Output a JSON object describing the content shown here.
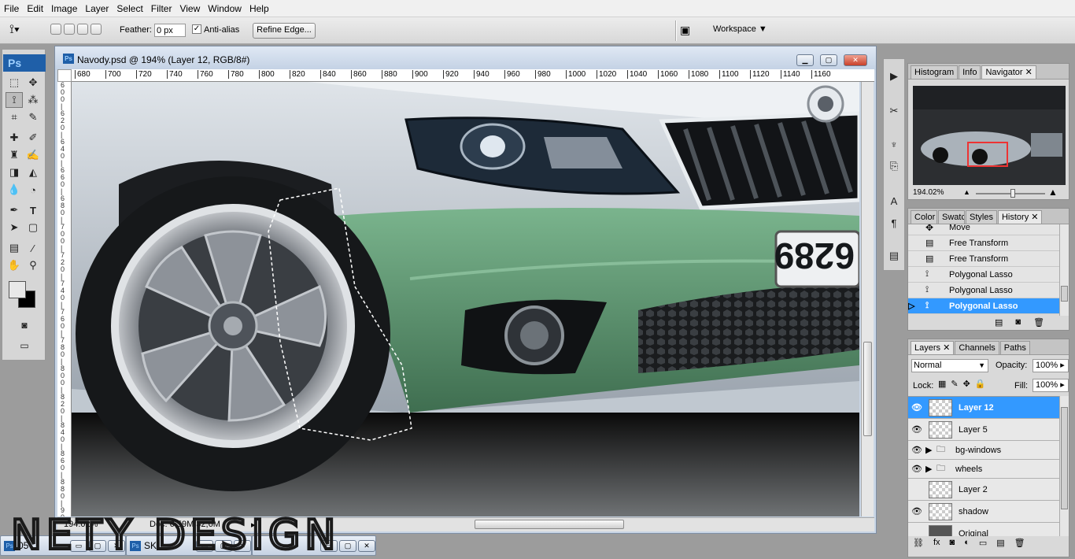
{
  "menu": [
    "File",
    "Edit",
    "Image",
    "Layer",
    "Select",
    "Filter",
    "View",
    "Window",
    "Help"
  ],
  "options": {
    "feather_label": "Feather:",
    "feather_value": "0 px",
    "antialias_label": "Anti-alias",
    "antialias_checked": true,
    "refine_edge": "Refine Edge...",
    "workspace": "Workspace"
  },
  "toolbox": {
    "logo": "Ps"
  },
  "document": {
    "title": "Navody.psd @ 194% (Layer 12, RGB/8#)",
    "ruler_ticks": [
      "680",
      "700",
      "720",
      "740",
      "760",
      "780",
      "800",
      "820",
      "840",
      "860",
      "880",
      "900",
      "920",
      "940",
      "960",
      "980",
      "1000",
      "1020",
      "1040",
      "1060",
      "1080",
      "1100",
      "1120",
      "1140",
      "1160"
    ],
    "plate_text": "6289",
    "zoom": "194.02%",
    "doc_info": "Doc: 6,59M/32,6M"
  },
  "navigator": {
    "tabs": [
      "Histogram",
      "Info",
      "Navigator"
    ],
    "active": "Navigator",
    "zoom": "194.02%"
  },
  "history": {
    "tabs": [
      "Color",
      "Swatc",
      "Styles",
      "History"
    ],
    "active": "History",
    "items": [
      "Move",
      "Free Transform",
      "Free Transform",
      "Polygonal Lasso",
      "Polygonal Lasso",
      "Polygonal Lasso"
    ],
    "selected_index": 5
  },
  "layers": {
    "tabs": [
      "Layers",
      "Channels",
      "Paths"
    ],
    "active": "Layers",
    "blend_mode": "Normal",
    "opacity_label": "Opacity:",
    "opacity": "100%",
    "lock_label": "Lock:",
    "fill_label": "Fill:",
    "fill": "100%",
    "items": [
      {
        "name": "Layer 12",
        "visible": true,
        "selected": true,
        "group": false
      },
      {
        "name": "Layer 5",
        "visible": true,
        "selected": false,
        "group": false
      },
      {
        "name": "bg-windows",
        "visible": true,
        "selected": false,
        "group": true
      },
      {
        "name": "wheels",
        "visible": true,
        "selected": false,
        "group": true
      },
      {
        "name": "Layer 2",
        "visible": false,
        "selected": false,
        "group": false
      },
      {
        "name": "shadow",
        "visible": true,
        "selected": false,
        "group": false
      },
      {
        "name": "Original",
        "visible": false,
        "selected": false,
        "group": false
      }
    ]
  },
  "taskbar": [
    "05",
    "SK"
  ],
  "watermark": "NETY DESIGN",
  "colors": {
    "selection": "#3399ff",
    "bumper_green": "#5f9a73",
    "body_silver": "#b8c0c8"
  }
}
